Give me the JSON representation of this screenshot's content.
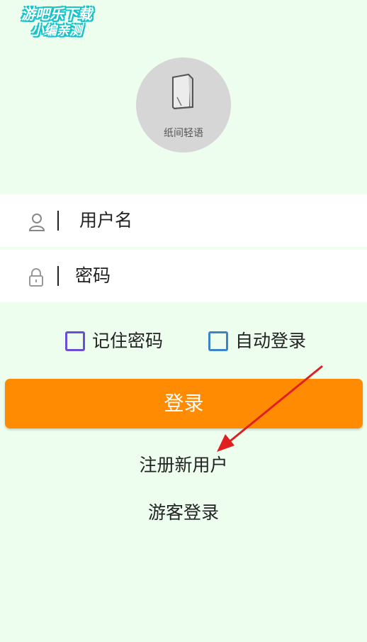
{
  "watermark": {
    "line1": "游吧乐下载",
    "line2": "小编亲测"
  },
  "logo": {
    "text": "纸间轻语",
    "icon": "book-icon"
  },
  "username": {
    "placeholder": "用户名",
    "icon": "user-icon"
  },
  "password": {
    "placeholder": "密码",
    "icon": "lock-icon"
  },
  "options": [
    {
      "label": "记住密码",
      "checked": false,
      "color": "#6a4fd6"
    },
    {
      "label": "自动登录",
      "checked": false,
      "color": "#3c84c6"
    }
  ],
  "login_button": {
    "label": "登录",
    "color": "#fe8b02"
  },
  "links": {
    "register": "注册新用户",
    "guest": "游客登录"
  },
  "colors": {
    "background": "#eefeee",
    "annotation_arrow": "#e02020"
  }
}
